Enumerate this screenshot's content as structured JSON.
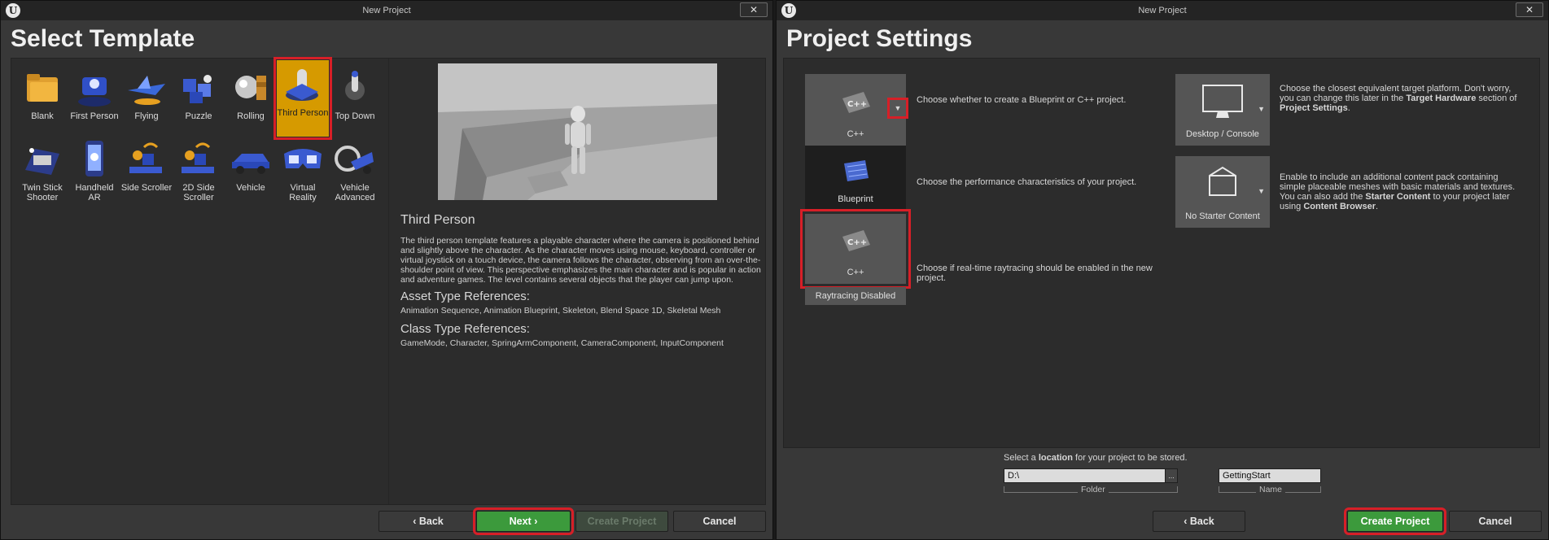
{
  "left_window": {
    "title": "New Project",
    "logo": "U",
    "close_label": "✕",
    "heading": "Select Template",
    "templates": [
      {
        "label": "Blank",
        "icon": "folder-icon"
      },
      {
        "label": "First Person",
        "icon": "first-person-icon"
      },
      {
        "label": "Flying",
        "icon": "flying-icon"
      },
      {
        "label": "Puzzle",
        "icon": "puzzle-icon"
      },
      {
        "label": "Rolling",
        "icon": "rolling-icon"
      },
      {
        "label": "Third Person",
        "icon": "third-person-icon"
      },
      {
        "label": "Top Down",
        "icon": "top-down-icon"
      },
      {
        "label": "Twin Stick Shooter",
        "icon": "twin-stick-icon"
      },
      {
        "label": "Handheld AR",
        "icon": "handheld-ar-icon"
      },
      {
        "label": "Side Scroller",
        "icon": "side-scroller-icon"
      },
      {
        "label": "2D Side Scroller",
        "icon": "2d-side-scroller-icon"
      },
      {
        "label": "Vehicle",
        "icon": "vehicle-icon"
      },
      {
        "label": "Virtual Reality",
        "icon": "vr-icon"
      },
      {
        "label": "Vehicle Advanced",
        "icon": "vehicle-advanced-icon"
      }
    ],
    "detail": {
      "title": "Third Person",
      "description": "The third person template features a playable character where the camera is positioned behind and slightly above the character. As the character moves using mouse, keyboard, controller or virtual joystick on a touch device, the camera follows the character, observing from an over-the-shoulder point of view. This perspective emphasizes the main character and is popular in action and adventure games. The level contains several objects that the player can jump upon.",
      "asset_heading": "Asset Type References:",
      "asset_list": "Animation Sequence, Animation Blueprint, Skeleton, Blend Space 1D, Skeletal Mesh",
      "class_heading": "Class Type References:",
      "class_list": "GameMode, Character, SpringArmComponent, CameraComponent, InputComponent"
    },
    "buttons": {
      "back": "‹ Back",
      "next": "Next ›",
      "create": "Create Project",
      "cancel": "Cancel"
    }
  },
  "right_window": {
    "title": "New Project",
    "logo": "U",
    "close_label": "✕",
    "heading": "Project Settings",
    "options": {
      "cpp_label": "C++",
      "cpp_icon_text": "C++",
      "cpp_desc": "Choose whether to create a Blueprint or C++ project.",
      "blueprint_label": "Blueprint",
      "perf_desc": "Choose the performance characteristics of your project.",
      "cpp2_label": "C++",
      "raytracing_label": "Raytracing Disabled",
      "raytracing_desc": "Choose if real-time raytracing should be enabled in the new project.",
      "platform_label": "Desktop / Console",
      "platform_desc_1": "Choose the closest equivalent target platform. Don't worry, you can change this later in the ",
      "platform_desc_bold1": "Target Hardware",
      "platform_desc_2": " section of ",
      "platform_desc_bold2": "Project Settings",
      "platform_desc_3": ".",
      "starter_label": "No Starter Content",
      "starter_desc_1": "Enable to include an additional content pack containing simple placeable meshes with basic materials and textures.",
      "starter_desc_2": "You can also add the ",
      "starter_desc_bold1": "Starter Content",
      "starter_desc_3": " to your project later using ",
      "starter_desc_bold2": "Content Browser",
      "starter_desc_4": "."
    },
    "location": {
      "prompt_1": "Select a ",
      "prompt_bold": "location",
      "prompt_2": " for your project to be stored.",
      "folder_value": "D:\\",
      "browse_label": "...",
      "folder_caption": "Folder",
      "name_value": "GettingStart",
      "name_caption": "Name"
    },
    "buttons": {
      "back": "‹ Back",
      "create": "Create Project",
      "cancel": "Cancel"
    }
  }
}
